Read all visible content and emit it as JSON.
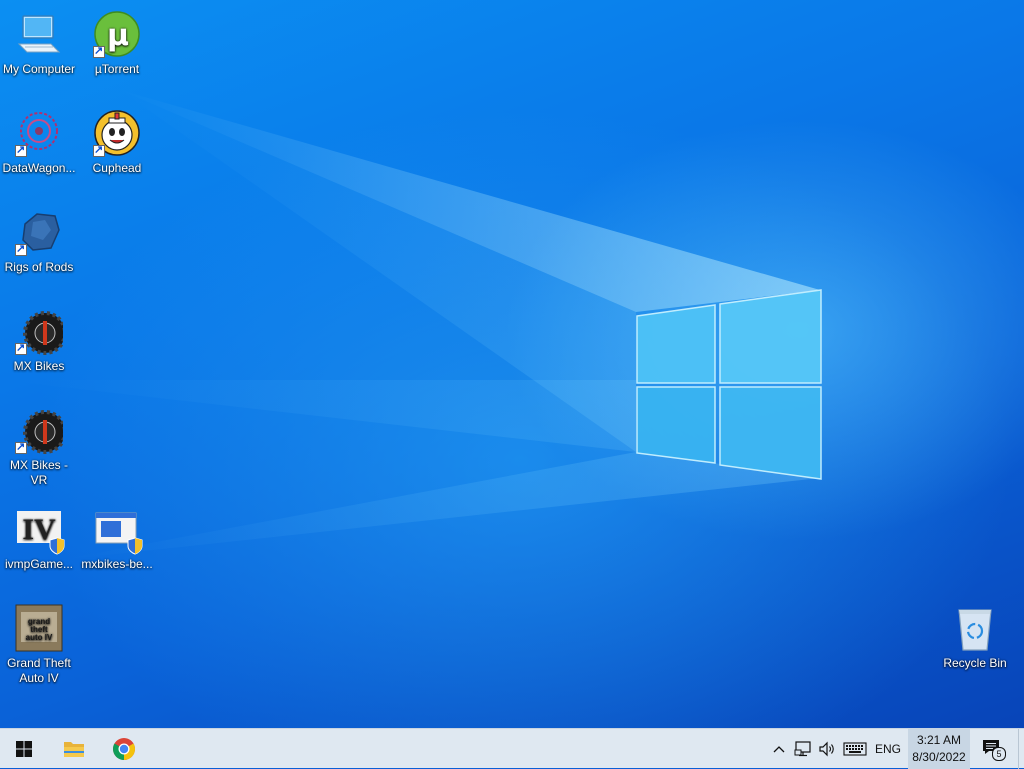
{
  "desktop": {
    "icons": [
      {
        "label": "My Computer",
        "icon": "computer-icon"
      },
      {
        "label": "µTorrent",
        "icon": "utorrent-icon"
      },
      {
        "label": "DataWagon...",
        "icon": "datawagon-icon"
      },
      {
        "label": "Cuphead",
        "icon": "cuphead-icon"
      },
      {
        "label": "Rigs of Rods",
        "icon": "rigs-of-rods-icon"
      },
      {
        "label": "MX Bikes",
        "icon": "mx-bikes-icon"
      },
      {
        "label": "MX Bikes - VR",
        "icon": "mx-bikes-vr-icon"
      },
      {
        "label": "ivmpGame...",
        "icon": "ivmp-icon"
      },
      {
        "label": "mxbikes-be...",
        "icon": "mxbikes-be-icon"
      },
      {
        "label": "Grand Theft Auto IV",
        "icon": "gta-iv-icon"
      },
      {
        "label": "Recycle Bin",
        "icon": "recycle-bin-icon"
      }
    ]
  },
  "taskbar": {
    "pinned": [
      {
        "name": "Start",
        "icon": "windows-start-icon"
      },
      {
        "name": "File Explorer",
        "icon": "folder-icon"
      },
      {
        "name": "Google Chrome",
        "icon": "chrome-icon"
      }
    ],
    "tray": {
      "language": "ENG",
      "time": "3:21 AM",
      "date": "8/30/2022",
      "notification_count": "5"
    }
  },
  "colors": {
    "taskbar_bg": "#dfe8f1",
    "desktop_accent": "#0a78e8"
  }
}
